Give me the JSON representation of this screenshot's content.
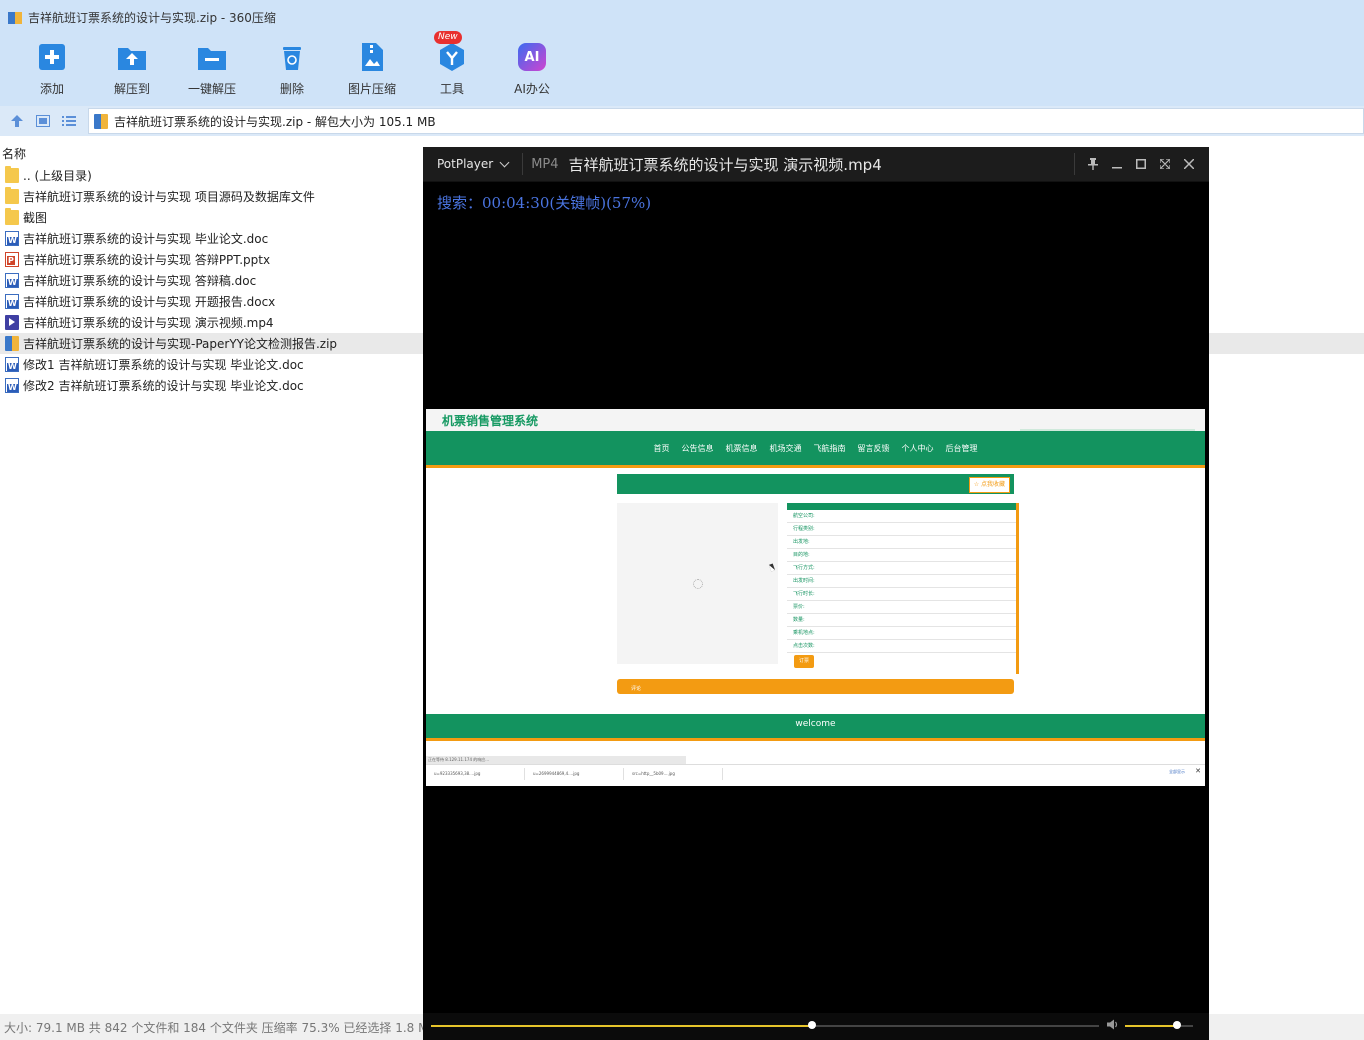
{
  "window": {
    "title": "吉祥航班订票系统的设计与实现.zip - 360压缩"
  },
  "toolbar": [
    {
      "label": "添加",
      "icon": "add-icon"
    },
    {
      "label": "解压到",
      "icon": "extract-to-icon"
    },
    {
      "label": "一键解压",
      "icon": "one-click-extract-icon"
    },
    {
      "label": "删除",
      "icon": "delete-icon"
    },
    {
      "label": "图片压缩",
      "icon": "image-compress-icon"
    },
    {
      "label": "工具",
      "icon": "tools-icon",
      "badge": "New"
    },
    {
      "label": "AI办公",
      "icon": "ai-office-icon",
      "icon_text": "AI"
    }
  ],
  "address": {
    "path": "吉祥航班订票系统的设计与实现.zip - 解包大小为 105.1 MB"
  },
  "filelist": {
    "column_name": "名称",
    "rows": [
      {
        "name": ".. (上级目录)",
        "type": "folder"
      },
      {
        "name": "吉祥航班订票系统的设计与实现 项目源码及数据库文件",
        "type": "folder"
      },
      {
        "name": "截图",
        "type": "folder"
      },
      {
        "name": "吉祥航班订票系统的设计与实现 毕业论文.doc",
        "type": "doc"
      },
      {
        "name": "吉祥航班订票系统的设计与实现 答辩PPT.pptx",
        "type": "ppt"
      },
      {
        "name": "吉祥航班订票系统的设计与实现 答辩稿.doc",
        "type": "doc"
      },
      {
        "name": "吉祥航班订票系统的设计与实现 开题报告.docx",
        "type": "doc"
      },
      {
        "name": "吉祥航班订票系统的设计与实现 演示视频.mp4",
        "type": "mp4"
      },
      {
        "name": "吉祥航班订票系统的设计与实现-PaperYY论文检测报告.zip",
        "type": "zip",
        "selected": true
      },
      {
        "name": "修改1 吉祥航班订票系统的设计与实现 毕业论文.doc",
        "type": "doc"
      },
      {
        "name": "修改2 吉祥航班订票系统的设计与实现 毕业论文.doc",
        "type": "doc"
      }
    ]
  },
  "status": {
    "text": "大小: 79.1 MB 共 842 个文件和 184 个文件夹 压缩率 75.3% 已经选择 1.8 M"
  },
  "player": {
    "brand": "PotPlayer",
    "format": "MP4",
    "file": "吉祥航班订票系统的设计与实现 演示视频.mp4",
    "osd": "搜索：00:04:30(关键帧)(57%)",
    "seek_fraction": 0.57,
    "volume_fraction": 0.77,
    "accent": "#e7c52b"
  },
  "video": {
    "site_name": "机票销售管理系统",
    "nav": [
      "首页",
      "公告信息",
      "机票信息",
      "机场交通",
      "飞航指南",
      "留言反馈",
      "个人中心",
      "后台管理"
    ],
    "fav_button": "☆ 点我收藏",
    "fields": [
      "航空公司:",
      "行程类别:",
      "出发地:",
      "目的地:",
      "飞行方式:",
      "出发时间:",
      "飞行时长:",
      "票价:",
      "数量:",
      "乘机地点:",
      "点击次数:"
    ],
    "order_button": "订票",
    "comment_tab": "评论",
    "footer": "welcome",
    "download_status": "正在等待 8.129.11.174 的响应...",
    "downloads": [
      "u=923335693,38....jpg",
      "u=2699944869,4....jpg",
      "src=http__5b09....jpg"
    ],
    "show_all": "全部显示",
    "brand_color": "#13935f",
    "accent_color": "#f39b12"
  }
}
